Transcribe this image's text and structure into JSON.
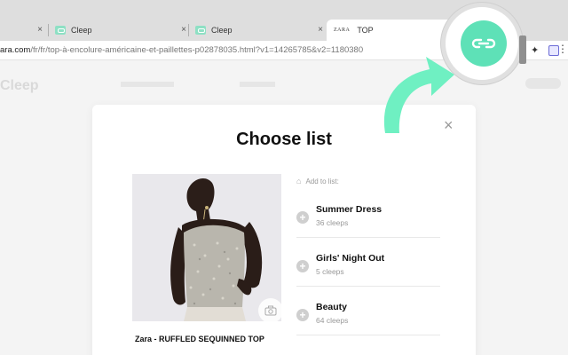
{
  "browser": {
    "tabs": [
      {
        "label": "",
        "close": "×"
      },
      {
        "label": "Cleep",
        "close": "×"
      },
      {
        "label": "Cleep",
        "close": "×"
      },
      {
        "label": "TOP",
        "favicon_text": "ZARA"
      }
    ],
    "url": {
      "host": "ara.com",
      "path": "/fr/fr/top-à-encolure-américaine-et-paillettes-p02878035.html?v1=14265785&v2=1180380"
    },
    "extension_icons": [
      "pin-icon",
      "extension-icon",
      "menu-icon"
    ]
  },
  "background_site": {
    "logo": "Cleep"
  },
  "modal": {
    "title": "Choose list",
    "close": "×",
    "add_to_list_label": "Add to list:",
    "product_name": "Zara - RUFFLED SEQUINNED TOP",
    "lists": [
      {
        "name": "Summer Dress",
        "count": "36 cleeps"
      },
      {
        "name": "Girls' Night Out",
        "count": "5 cleeps"
      },
      {
        "name": "Beauty",
        "count": "64 cleeps"
      }
    ]
  },
  "colors": {
    "accent": "#5ee1b7",
    "arrow": "#6ff0c2"
  }
}
